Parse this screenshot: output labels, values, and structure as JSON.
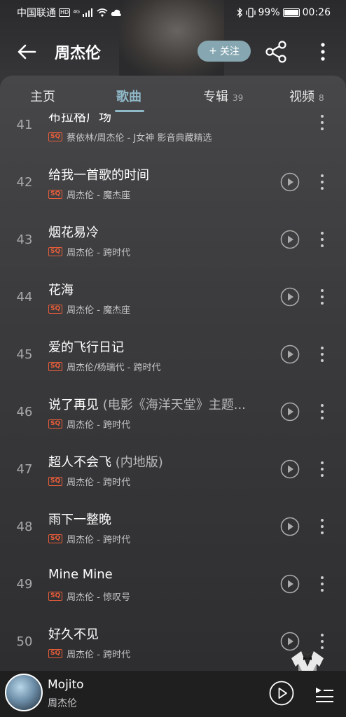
{
  "status": {
    "carrier": "中国联通",
    "hd": "HD",
    "signal_text": "⁴ᴳ",
    "battery": "99%",
    "time": "00:26"
  },
  "header": {
    "title": "周杰伦",
    "follow_label": "关注"
  },
  "tabs": [
    {
      "label": "主页",
      "count": ""
    },
    {
      "label": "歌曲",
      "count": ""
    },
    {
      "label": "专辑",
      "count": "39"
    },
    {
      "label": "视频",
      "count": "8"
    }
  ],
  "songs": [
    {
      "num": "41",
      "title": "布拉格广场",
      "suffix": "",
      "meta": "蔡依林/周杰伦 - J女神 影音典藏精选",
      "quality": "SQ"
    },
    {
      "num": "42",
      "title": "给我一首歌的时间",
      "suffix": "",
      "meta": "周杰伦 - 魔杰座",
      "quality": "SQ"
    },
    {
      "num": "43",
      "title": "烟花易冷",
      "suffix": "",
      "meta": "周杰伦 - 跨时代",
      "quality": "SQ"
    },
    {
      "num": "44",
      "title": "花海",
      "suffix": "",
      "meta": "周杰伦 - 魔杰座",
      "quality": "SQ"
    },
    {
      "num": "45",
      "title": "爱的飞行日记",
      "suffix": "",
      "meta": "周杰伦/杨瑞代 - 跨时代",
      "quality": "SQ"
    },
    {
      "num": "46",
      "title": "说了再见",
      "suffix": " (电影《海洋天堂》主题...",
      "meta": "周杰伦 - 跨时代",
      "quality": "SQ"
    },
    {
      "num": "47",
      "title": "超人不会飞",
      "suffix": " (内地版)",
      "meta": "周杰伦 - 跨时代",
      "quality": "SQ"
    },
    {
      "num": "48",
      "title": "雨下一整晚",
      "suffix": "",
      "meta": "周杰伦 - 跨时代",
      "quality": "SQ"
    },
    {
      "num": "49",
      "title": "Mine Mine",
      "suffix": "",
      "meta": "周杰伦 - 惊叹号",
      "quality": "SQ"
    },
    {
      "num": "50",
      "title": "好久不见",
      "suffix": "",
      "meta": "周杰伦 - 跨时代",
      "quality": "SQ"
    }
  ],
  "player": {
    "title": "Mojito",
    "artist": "周杰伦"
  },
  "colors": {
    "accent": "#8fb8c8",
    "sq_badge": "#e85d3a",
    "follow_bg": "#86a7b1"
  }
}
